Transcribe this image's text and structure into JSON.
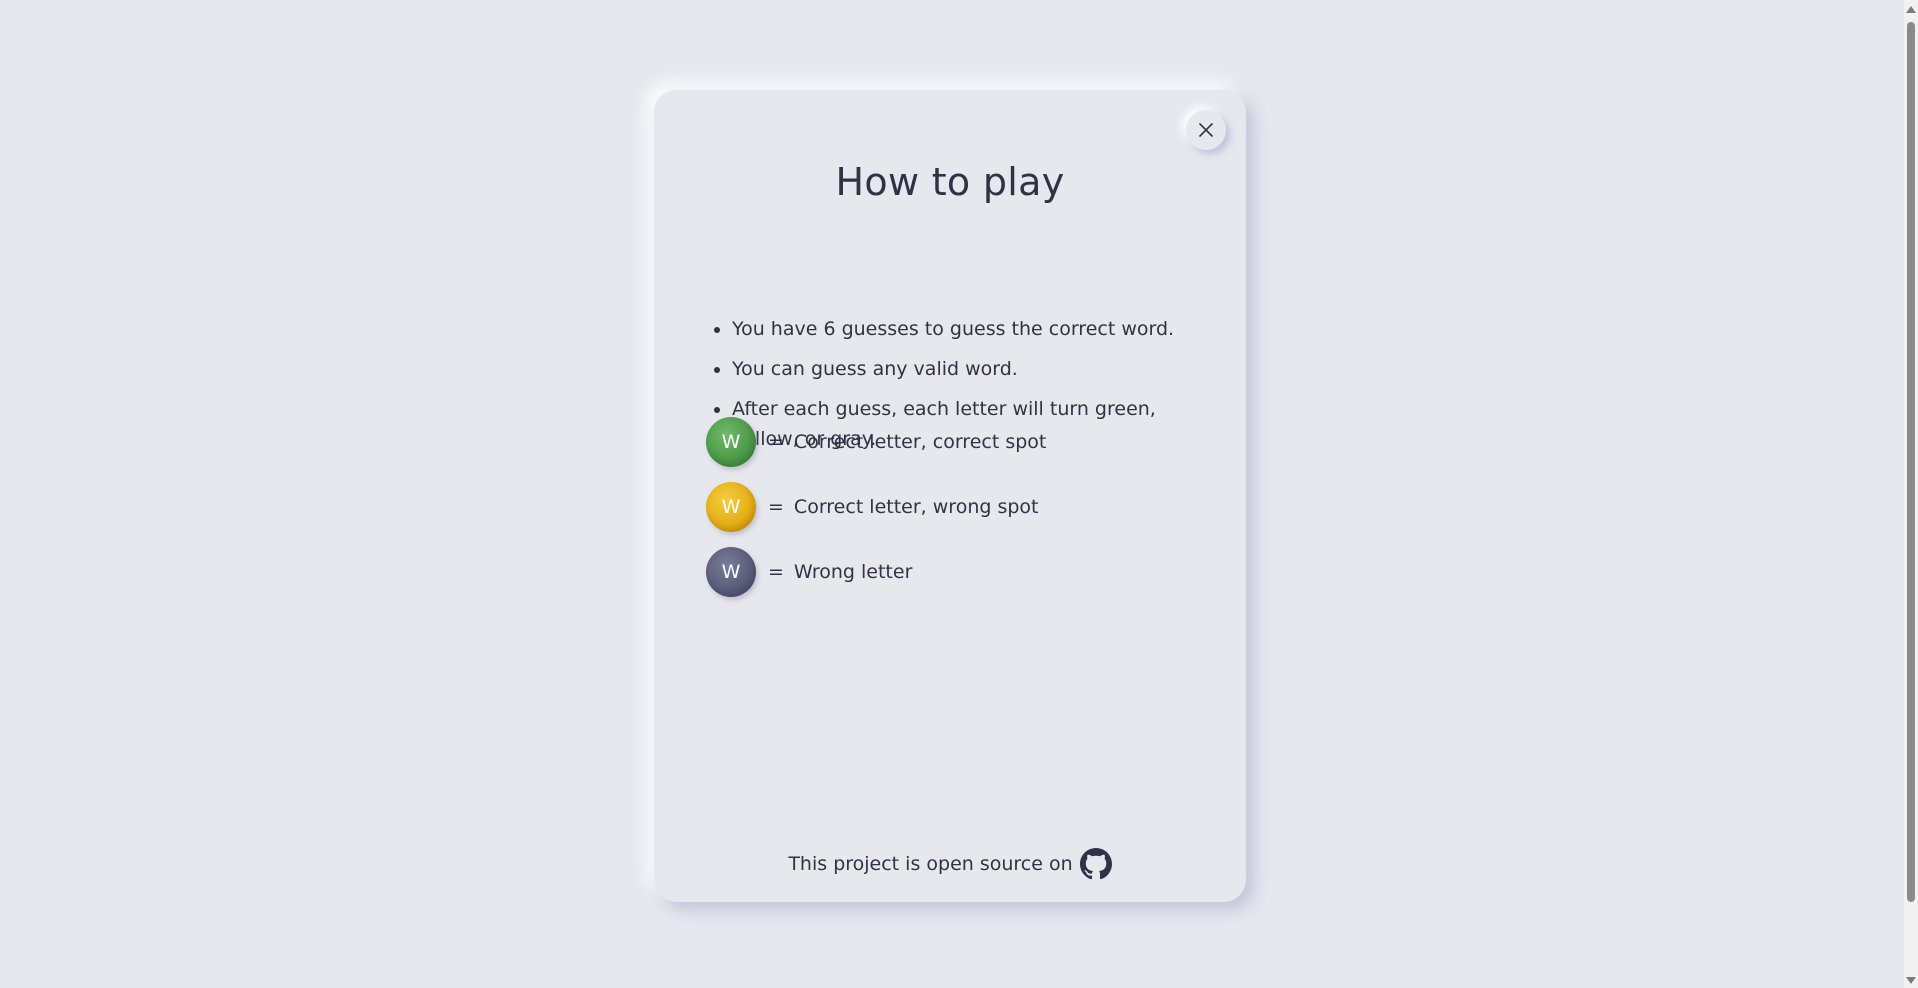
{
  "modal": {
    "title": "How to play",
    "close_icon": "close-icon",
    "rules": [
      "You have 6 guesses to guess the correct word.",
      "You can guess any valid word.",
      "After each guess, each letter will turn green, yellow, or gray."
    ],
    "legend": [
      {
        "letter": "W",
        "color": "#4a9846",
        "equals": "=",
        "text": "Correct letter, correct spot"
      },
      {
        "letter": "W",
        "color": "#e3ad13",
        "equals": "=",
        "text": "Correct letter, wrong spot"
      },
      {
        "letter": "W",
        "color": "#575b78",
        "equals": "=",
        "text": "Wrong letter"
      }
    ],
    "footer_text": "This project is open source on",
    "footer_icon": "github-icon"
  },
  "colors": {
    "background": "#e7e8ee",
    "text": "#2f3345"
  }
}
